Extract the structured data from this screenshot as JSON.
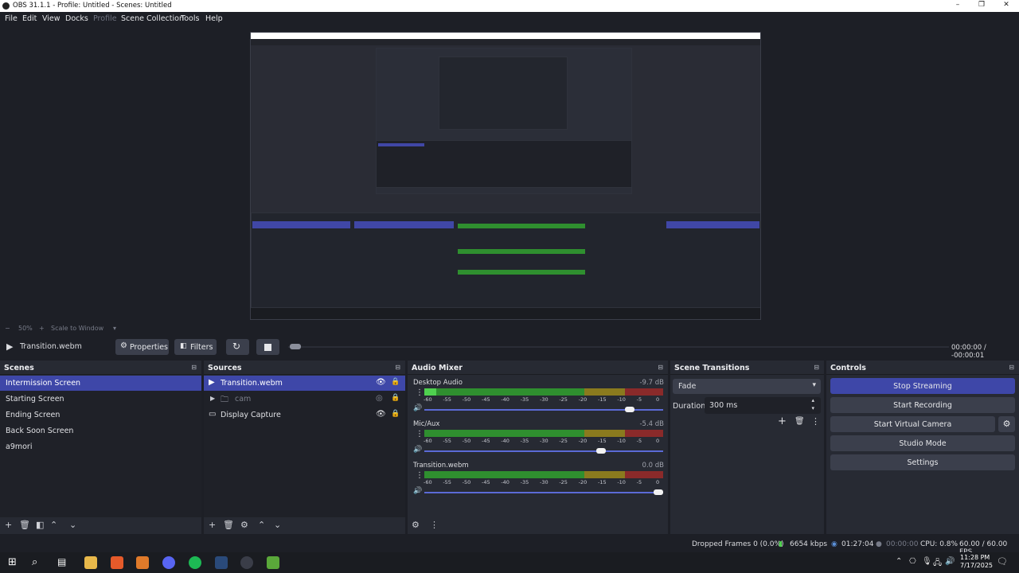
{
  "window": {
    "title": "OBS 31.1.1 - Profile: Untitled - Scenes: Untitled",
    "min": "–",
    "max": "❐",
    "close": "✕"
  },
  "menu": [
    "File",
    "Edit",
    "View",
    "Docks",
    "Profile",
    "Scene Collection",
    "Tools",
    "Help"
  ],
  "preview": {
    "zoom": "50%",
    "scale_mode": "Scale to Window"
  },
  "media": {
    "source": "Transition.webm",
    "time": "00:00:00  /  -00:00:01",
    "properties": "Properties",
    "filters": "Filters"
  },
  "scenes": {
    "title": "Scenes",
    "items": [
      "Intermission Screen",
      "Starting Screen",
      "Ending Screen",
      "Back Soon Screen",
      "a9mori"
    ]
  },
  "sources": {
    "title": "Sources",
    "items": [
      "Transition.webm",
      "cam",
      "Display Capture"
    ]
  },
  "audio": {
    "title": "Audio Mixer",
    "channels": [
      {
        "name": "Desktop Audio",
        "db": "-9.7 dB",
        "level": 0.05,
        "volume": 0.88
      },
      {
        "name": "Mic/Aux",
        "db": "-5.4 dB",
        "level": 0.0,
        "volume": 0.76
      },
      {
        "name": "Transition.webm",
        "db": "0.0 dB",
        "level": 0.0,
        "volume": 1.0
      }
    ],
    "ticks": [
      "-60",
      "-55",
      "-50",
      "-45",
      "-40",
      "-35",
      "-30",
      "-25",
      "-20",
      "-15",
      "-10",
      "-5",
      "0"
    ]
  },
  "transitions": {
    "title": "Scene Transitions",
    "type": "Fade",
    "duration_label": "Duration",
    "duration": "300 ms"
  },
  "controls": {
    "title": "Controls",
    "buttons": [
      "Stop Streaming",
      "Start Recording",
      "Start Virtual Camera",
      "Studio Mode",
      "Settings"
    ]
  },
  "status": {
    "dropped": "Dropped Frames 0 (0.0%)",
    "kbps": "6654 kbps",
    "stream_time": "01:27:04",
    "rec_time": "00:00:00",
    "cpu": "CPU: 0.8%",
    "fps": "60.00 / 60.00 FPS"
  },
  "taskbar": {
    "time": "11:28 PM",
    "date": "7/17/2025"
  },
  "colors": {
    "accent": "#3e47a8",
    "panel": "#272a33",
    "bg": "#1d1f26"
  }
}
